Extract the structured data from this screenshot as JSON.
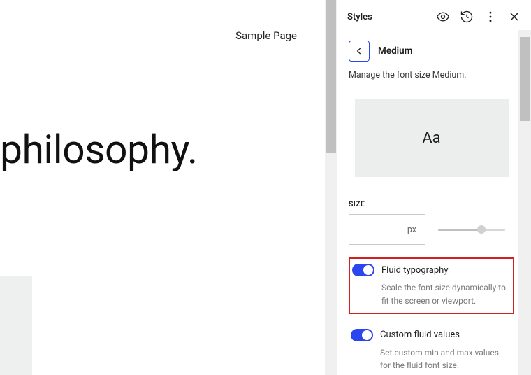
{
  "canvas": {
    "nav_link": "Sample Page",
    "heading": "philosophy."
  },
  "panel": {
    "title": "Styles",
    "back_label": "Medium",
    "description": "Manage the font size Medium.",
    "preview_sample": "Aa",
    "size_section_label": "SIZE",
    "size_unit": "px",
    "options": {
      "fluid": {
        "label": "Fluid typography",
        "desc": "Scale the font size dynamically to fit the screen or viewport.",
        "enabled": true
      },
      "custom": {
        "label": "Custom fluid values",
        "desc": "Set custom min and max values for the fluid font size.",
        "enabled": true
      }
    }
  }
}
